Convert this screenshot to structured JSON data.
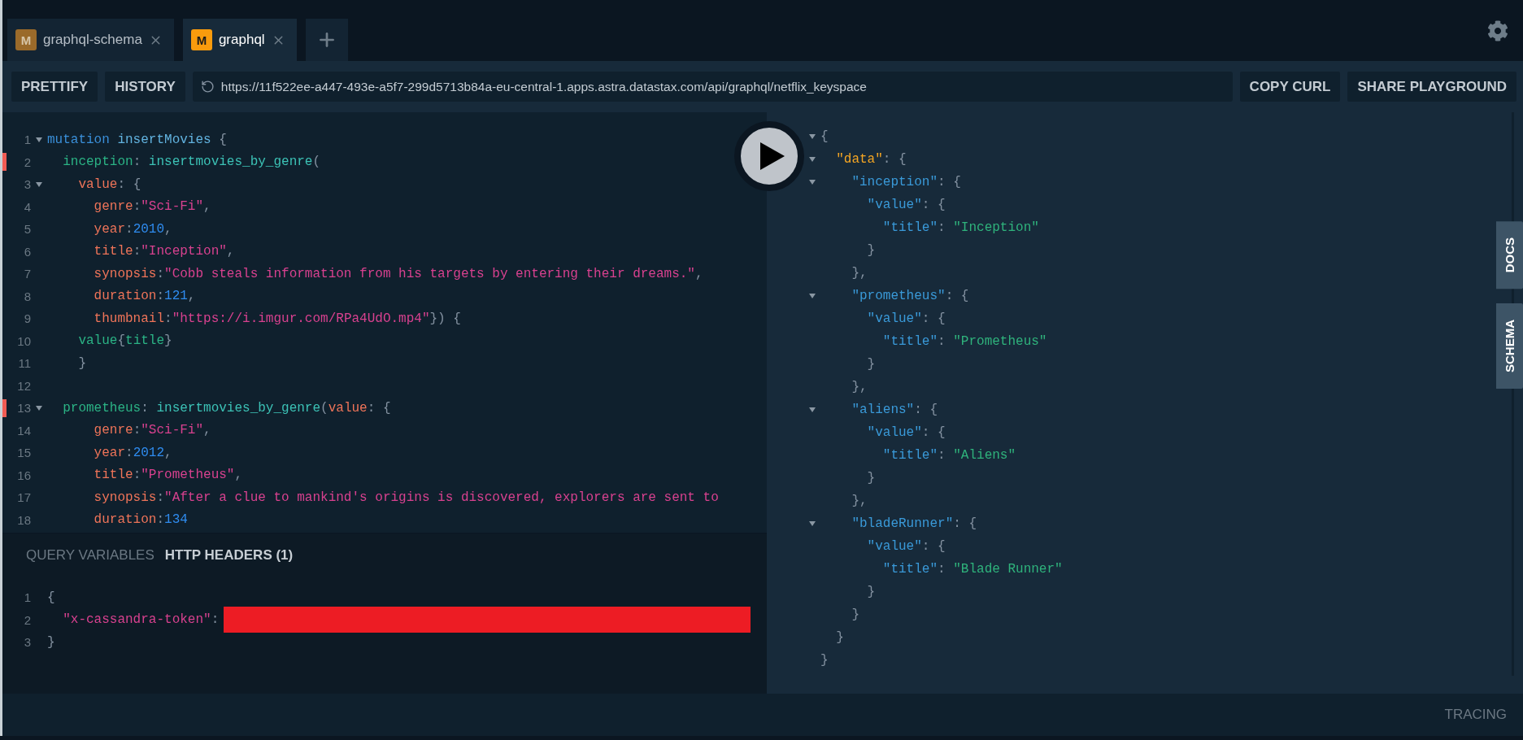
{
  "tabs": [
    {
      "badge": "M",
      "label": "graphql-schema",
      "selected": false
    },
    {
      "badge": "M",
      "label": "graphql",
      "selected": true
    }
  ],
  "toolbar": {
    "left_buttons": [
      "PRETTIFY",
      "HISTORY"
    ],
    "url": "https://11f522ee-a447-493e-a5f7-299d5713b84a-eu-central-1.apps.astra.datastax.com/api/graphql/netflix_keyspace",
    "right_buttons": [
      "COPY CURL",
      "SHARE PLAYGROUND"
    ]
  },
  "editor": {
    "lines": [
      {
        "number": "1",
        "foldable": true,
        "marked": false,
        "tokens": [
          {
            "kind": "keyword",
            "text": "mutation"
          },
          {
            "kind": "def",
            "text": " insertMovies"
          },
          {
            "kind": "punct",
            "text": " {"
          }
        ]
      },
      {
        "number": "2",
        "foldable": false,
        "marked": true,
        "tokens": [
          {
            "kind": "field",
            "text": "  inception"
          },
          {
            "kind": "punct",
            "text": ": "
          },
          {
            "kind": "call",
            "text": "insertmovies_by_genre"
          },
          {
            "kind": "punct",
            "text": "("
          }
        ]
      },
      {
        "number": "3",
        "foldable": true,
        "marked": false,
        "tokens": [
          {
            "kind": "arg",
            "text": "    value"
          },
          {
            "kind": "punct",
            "text": ": {"
          }
        ]
      },
      {
        "number": "4",
        "foldable": false,
        "marked": false,
        "tokens": [
          {
            "kind": "arg",
            "text": "      genre"
          },
          {
            "kind": "punct",
            "text": ":"
          },
          {
            "kind": "string",
            "text": "\"Sci-Fi\""
          },
          {
            "kind": "punct",
            "text": ","
          }
        ]
      },
      {
        "number": "5",
        "foldable": false,
        "marked": false,
        "tokens": [
          {
            "kind": "arg",
            "text": "      year"
          },
          {
            "kind": "punct",
            "text": ":"
          },
          {
            "kind": "number",
            "text": "2010"
          },
          {
            "kind": "punct",
            "text": ","
          }
        ]
      },
      {
        "number": "6",
        "foldable": false,
        "marked": false,
        "tokens": [
          {
            "kind": "arg",
            "text": "      title"
          },
          {
            "kind": "punct",
            "text": ":"
          },
          {
            "kind": "string",
            "text": "\"Inception\""
          },
          {
            "kind": "punct",
            "text": ","
          }
        ]
      },
      {
        "number": "7",
        "foldable": false,
        "marked": false,
        "tokens": [
          {
            "kind": "arg",
            "text": "      synopsis"
          },
          {
            "kind": "punct",
            "text": ":"
          },
          {
            "kind": "string",
            "text": "\"Cobb steals information from his targets by entering their dreams.\""
          },
          {
            "kind": "punct",
            "text": ","
          }
        ]
      },
      {
        "number": "8",
        "foldable": false,
        "marked": false,
        "tokens": [
          {
            "kind": "arg",
            "text": "      duration"
          },
          {
            "kind": "punct",
            "text": ":"
          },
          {
            "kind": "number",
            "text": "121"
          },
          {
            "kind": "punct",
            "text": ","
          }
        ]
      },
      {
        "number": "9",
        "foldable": false,
        "marked": false,
        "tokens": [
          {
            "kind": "arg",
            "text": "      thumbnail"
          },
          {
            "kind": "punct",
            "text": ":"
          },
          {
            "kind": "string",
            "text": "\"https://i.imgur.com/RPa4UdO.mp4\""
          },
          {
            "kind": "punct",
            "text": "}) {"
          }
        ]
      },
      {
        "number": "10",
        "foldable": false,
        "marked": false,
        "tokens": [
          {
            "kind": "field",
            "text": "    value"
          },
          {
            "kind": "punct",
            "text": "{"
          },
          {
            "kind": "field",
            "text": "title"
          },
          {
            "kind": "punct",
            "text": "}"
          }
        ]
      },
      {
        "number": "11",
        "foldable": false,
        "marked": false,
        "tokens": [
          {
            "kind": "punct",
            "text": "    }"
          }
        ]
      },
      {
        "number": "12",
        "foldable": false,
        "marked": false
      },
      {
        "number": "13",
        "foldable": true,
        "marked": true,
        "tokens": [
          {
            "kind": "field",
            "text": "  prometheus"
          },
          {
            "kind": "punct",
            "text": ": "
          },
          {
            "kind": "call",
            "text": "insertmovies_by_genre"
          },
          {
            "kind": "punct",
            "text": "("
          },
          {
            "kind": "arg",
            "text": "value"
          },
          {
            "kind": "punct",
            "text": ": {"
          }
        ]
      },
      {
        "number": "14",
        "foldable": false,
        "marked": false,
        "tokens": [
          {
            "kind": "arg",
            "text": "      genre"
          },
          {
            "kind": "punct",
            "text": ":"
          },
          {
            "kind": "string",
            "text": "\"Sci-Fi\""
          },
          {
            "kind": "punct",
            "text": ","
          }
        ]
      },
      {
        "number": "15",
        "foldable": false,
        "marked": false,
        "tokens": [
          {
            "kind": "arg",
            "text": "      year"
          },
          {
            "kind": "punct",
            "text": ":"
          },
          {
            "kind": "number",
            "text": "2012"
          },
          {
            "kind": "punct",
            "text": ","
          }
        ]
      },
      {
        "number": "16",
        "foldable": false,
        "marked": false,
        "tokens": [
          {
            "kind": "arg",
            "text": "      title"
          },
          {
            "kind": "punct",
            "text": ":"
          },
          {
            "kind": "string",
            "text": "\"Prometheus\""
          },
          {
            "kind": "punct",
            "text": ","
          }
        ]
      },
      {
        "number": "17",
        "foldable": false,
        "marked": false,
        "tokens": [
          {
            "kind": "arg",
            "text": "      synopsis"
          },
          {
            "kind": "punct",
            "text": ":"
          },
          {
            "kind": "string",
            "text": "\"After a clue to mankind's origins is discovered, explorers are sent to"
          }
        ]
      },
      {
        "number": "18",
        "foldable": false,
        "marked": false,
        "tokens": [
          {
            "kind": "arg",
            "text": "      duration"
          },
          {
            "kind": "punct",
            "text": ":"
          },
          {
            "kind": "number",
            "text": "134"
          }
        ]
      }
    ]
  },
  "bottom_panel": {
    "tabs": [
      {
        "label": "QUERY VARIABLES",
        "selected": false
      },
      {
        "label": "HTTP HEADERS (1)",
        "selected": true
      }
    ],
    "lines": [
      {
        "number": "1",
        "redacted": false,
        "tokens": [
          {
            "kind": "punct",
            "text": "{"
          }
        ]
      },
      {
        "number": "2",
        "redacted": true,
        "tokens": [
          {
            "kind": "string",
            "text": "  \"x-cassandra-token\""
          },
          {
            "kind": "punct",
            "text": ":"
          }
        ]
      },
      {
        "number": "3",
        "redacted": false,
        "tokens": [
          {
            "kind": "punct",
            "text": "}"
          }
        ]
      }
    ]
  },
  "result": {
    "lines": [
      {
        "foldable": true,
        "tokens": [
          {
            "kind": "punct",
            "text": "{"
          }
        ]
      },
      {
        "foldable": true,
        "tokens": [
          {
            "kind": "datakey",
            "text": "  \"data\""
          },
          {
            "kind": "punct",
            "text": ": {"
          }
        ]
      },
      {
        "foldable": true,
        "tokens": [
          {
            "kind": "key",
            "text": "    \"inception\""
          },
          {
            "kind": "punct",
            "text": ": {"
          }
        ]
      },
      {
        "foldable": false,
        "tokens": [
          {
            "kind": "key",
            "text": "      \"value\""
          },
          {
            "kind": "punct",
            "text": ": {"
          }
        ]
      },
      {
        "foldable": false,
        "tokens": [
          {
            "kind": "key",
            "text": "        \"title\""
          },
          {
            "kind": "punct",
            "text": ": "
          },
          {
            "kind": "rstring",
            "text": "\"Inception\""
          }
        ]
      },
      {
        "foldable": false,
        "tokens": [
          {
            "kind": "punct",
            "text": "      }"
          }
        ]
      },
      {
        "foldable": false,
        "tokens": [
          {
            "kind": "punct",
            "text": "    },"
          }
        ]
      },
      {
        "foldable": true,
        "tokens": [
          {
            "kind": "key",
            "text": "    \"prometheus\""
          },
          {
            "kind": "punct",
            "text": ": {"
          }
        ]
      },
      {
        "foldable": false,
        "tokens": [
          {
            "kind": "key",
            "text": "      \"value\""
          },
          {
            "kind": "punct",
            "text": ": {"
          }
        ]
      },
      {
        "foldable": false,
        "tokens": [
          {
            "kind": "key",
            "text": "        \"title\""
          },
          {
            "kind": "punct",
            "text": ": "
          },
          {
            "kind": "rstring",
            "text": "\"Prometheus\""
          }
        ]
      },
      {
        "foldable": false,
        "tokens": [
          {
            "kind": "punct",
            "text": "      }"
          }
        ]
      },
      {
        "foldable": false,
        "tokens": [
          {
            "kind": "punct",
            "text": "    },"
          }
        ]
      },
      {
        "foldable": true,
        "tokens": [
          {
            "kind": "key",
            "text": "    \"aliens\""
          },
          {
            "kind": "punct",
            "text": ": {"
          }
        ]
      },
      {
        "foldable": false,
        "tokens": [
          {
            "kind": "key",
            "text": "      \"value\""
          },
          {
            "kind": "punct",
            "text": ": {"
          }
        ]
      },
      {
        "foldable": false,
        "tokens": [
          {
            "kind": "key",
            "text": "        \"title\""
          },
          {
            "kind": "punct",
            "text": ": "
          },
          {
            "kind": "rstring",
            "text": "\"Aliens\""
          }
        ]
      },
      {
        "foldable": false,
        "tokens": [
          {
            "kind": "punct",
            "text": "      }"
          }
        ]
      },
      {
        "foldable": false,
        "tokens": [
          {
            "kind": "punct",
            "text": "    },"
          }
        ]
      },
      {
        "foldable": true,
        "tokens": [
          {
            "kind": "key",
            "text": "    \"bladeRunner\""
          },
          {
            "kind": "punct",
            "text": ": {"
          }
        ]
      },
      {
        "foldable": false,
        "tokens": [
          {
            "kind": "key",
            "text": "      \"value\""
          },
          {
            "kind": "punct",
            "text": ": {"
          }
        ]
      },
      {
        "foldable": false,
        "tokens": [
          {
            "kind": "key",
            "text": "        \"title\""
          },
          {
            "kind": "punct",
            "text": ": "
          },
          {
            "kind": "rstring",
            "text": "\"Blade Runner\""
          }
        ]
      },
      {
        "foldable": false,
        "tokens": [
          {
            "kind": "punct",
            "text": "      }"
          }
        ]
      },
      {
        "foldable": false,
        "tokens": [
          {
            "kind": "punct",
            "text": "    }"
          }
        ]
      },
      {
        "foldable": false,
        "tokens": [
          {
            "kind": "punct",
            "text": "  }"
          }
        ]
      },
      {
        "foldable": false,
        "tokens": [
          {
            "kind": "punct",
            "text": "}"
          }
        ]
      }
    ]
  },
  "side_tabs": [
    "DOCS",
    "SCHEMA"
  ],
  "footer": {
    "label": "TRACING"
  }
}
